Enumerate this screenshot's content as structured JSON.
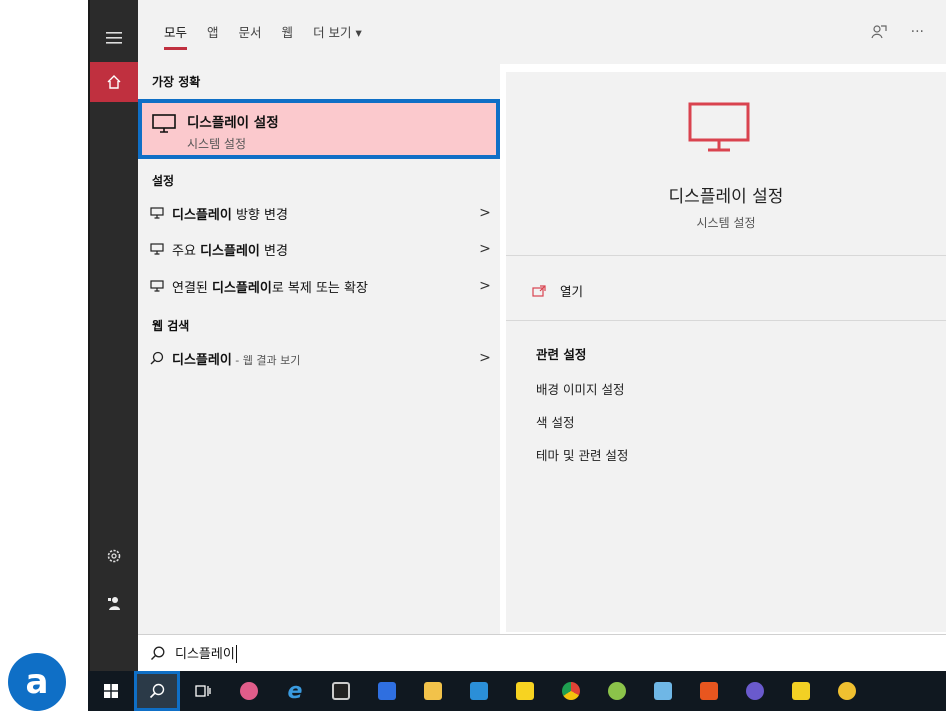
{
  "tabs": [
    {
      "label": "모두",
      "active": true
    },
    {
      "label": "앱",
      "active": false
    },
    {
      "label": "문서",
      "active": false
    },
    {
      "label": "웹",
      "active": false
    },
    {
      "label": "더 보기 ▾",
      "active": false
    }
  ],
  "top_actions": {
    "feedback_icon": "feedback-person-icon",
    "more": "···"
  },
  "results": {
    "best_match_heading": "가장 정확",
    "best_match": {
      "title": "디스플레이 설정",
      "subtitle": "시스템 설정",
      "icon": "monitor-icon"
    },
    "settings_heading": "설정",
    "settings": [
      {
        "bold": "디스플레이",
        "rest": " 방향 변경",
        "chevron": ">"
      },
      {
        "pre": "주요 ",
        "bold": "디스플레이",
        "rest": " 변경",
        "chevron": ">"
      },
      {
        "pre": "연결된 ",
        "bold": "디스플레이",
        "rest": "로 복제 또는 확장",
        "chevron": ">"
      }
    ],
    "web_heading": "웹 검색",
    "web": {
      "bold": "디스플레이",
      "small": " - 웹 결과 보기",
      "chevron": ">"
    }
  },
  "preview": {
    "title": "디스플레이 설정",
    "subtitle": "시스템 설정",
    "open_label": "열기",
    "related_heading": "관련 설정",
    "related": [
      "배경 이미지 설정",
      "색 설정",
      "테마 및 관련 설정"
    ]
  },
  "search": {
    "query": "디스플레이"
  },
  "badge": "a",
  "colors": {
    "accent_red": "#c0303f",
    "highlight": "#fbc9cd",
    "selection_blue": "#0f6fc6",
    "taskbar": "#101820"
  }
}
